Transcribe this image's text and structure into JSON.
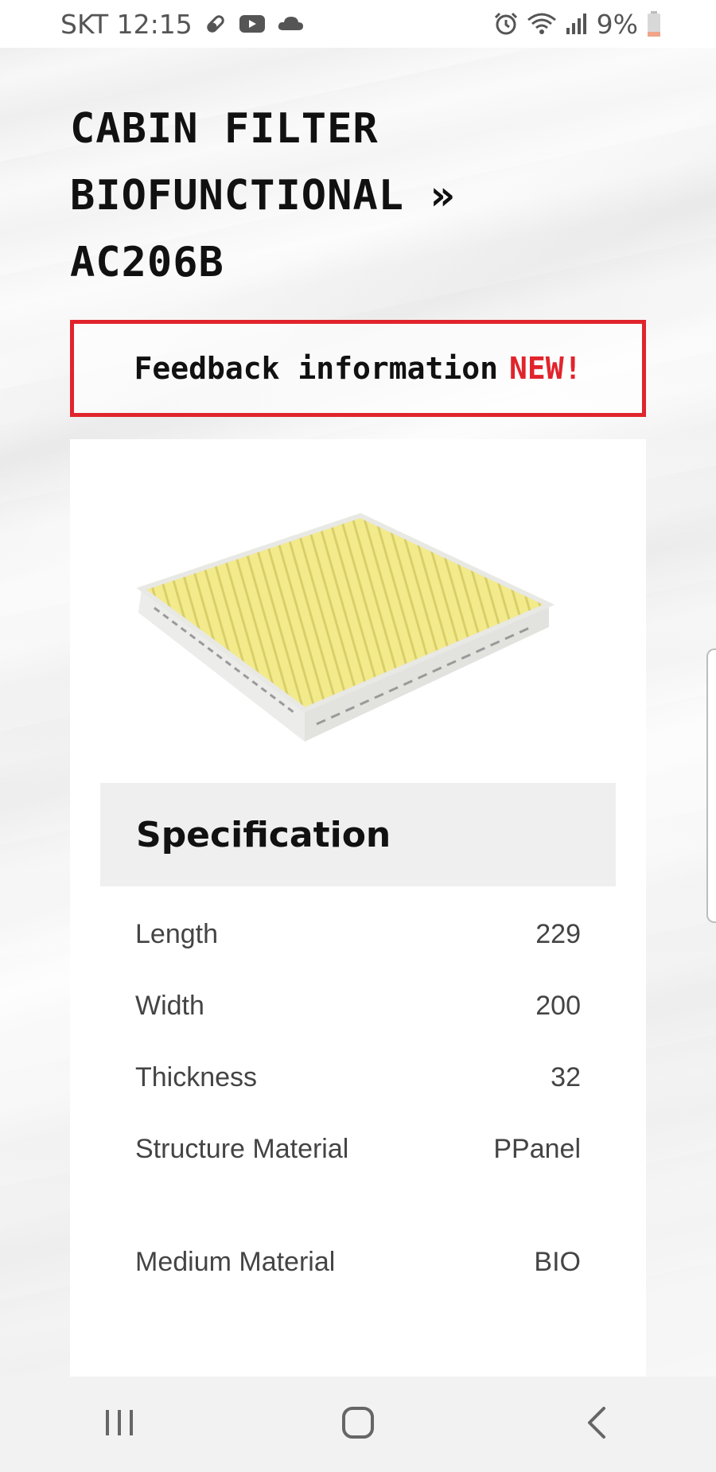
{
  "status_bar": {
    "carrier_time": "SKT 12:15",
    "battery": "9%",
    "icons_left": [
      "pill-icon",
      "youtube-icon",
      "cloud-icon"
    ],
    "icons_right": [
      "alarm-icon",
      "wifi-icon",
      "signal-icon",
      "battery-icon"
    ]
  },
  "page": {
    "title_line1": "CABIN FILTER",
    "title_line2": "BIOFUNCTIONAL »",
    "title_line3": "AC206B",
    "feedback": {
      "label": "Feedback information",
      "badge": "NEW!"
    },
    "product_image": "cabin-filter-image",
    "spec_heading": "Specification",
    "specs": [
      {
        "label": "Length",
        "value": "229"
      },
      {
        "label": "Width",
        "value": "200"
      },
      {
        "label": "Thickness",
        "value": "32"
      },
      {
        "label": "Structure Material",
        "value": "PPanel"
      },
      {
        "label": "Medium Material",
        "value": "BIO"
      }
    ]
  },
  "nav_bar": {
    "buttons": [
      "recent-apps-icon",
      "home-icon",
      "back-icon"
    ]
  },
  "colors": {
    "accent": "#e1242c",
    "text": "#111111",
    "spec_text": "#444444",
    "spec_header_bg": "#efefef",
    "filter_yellow": "#f3ea8c"
  }
}
